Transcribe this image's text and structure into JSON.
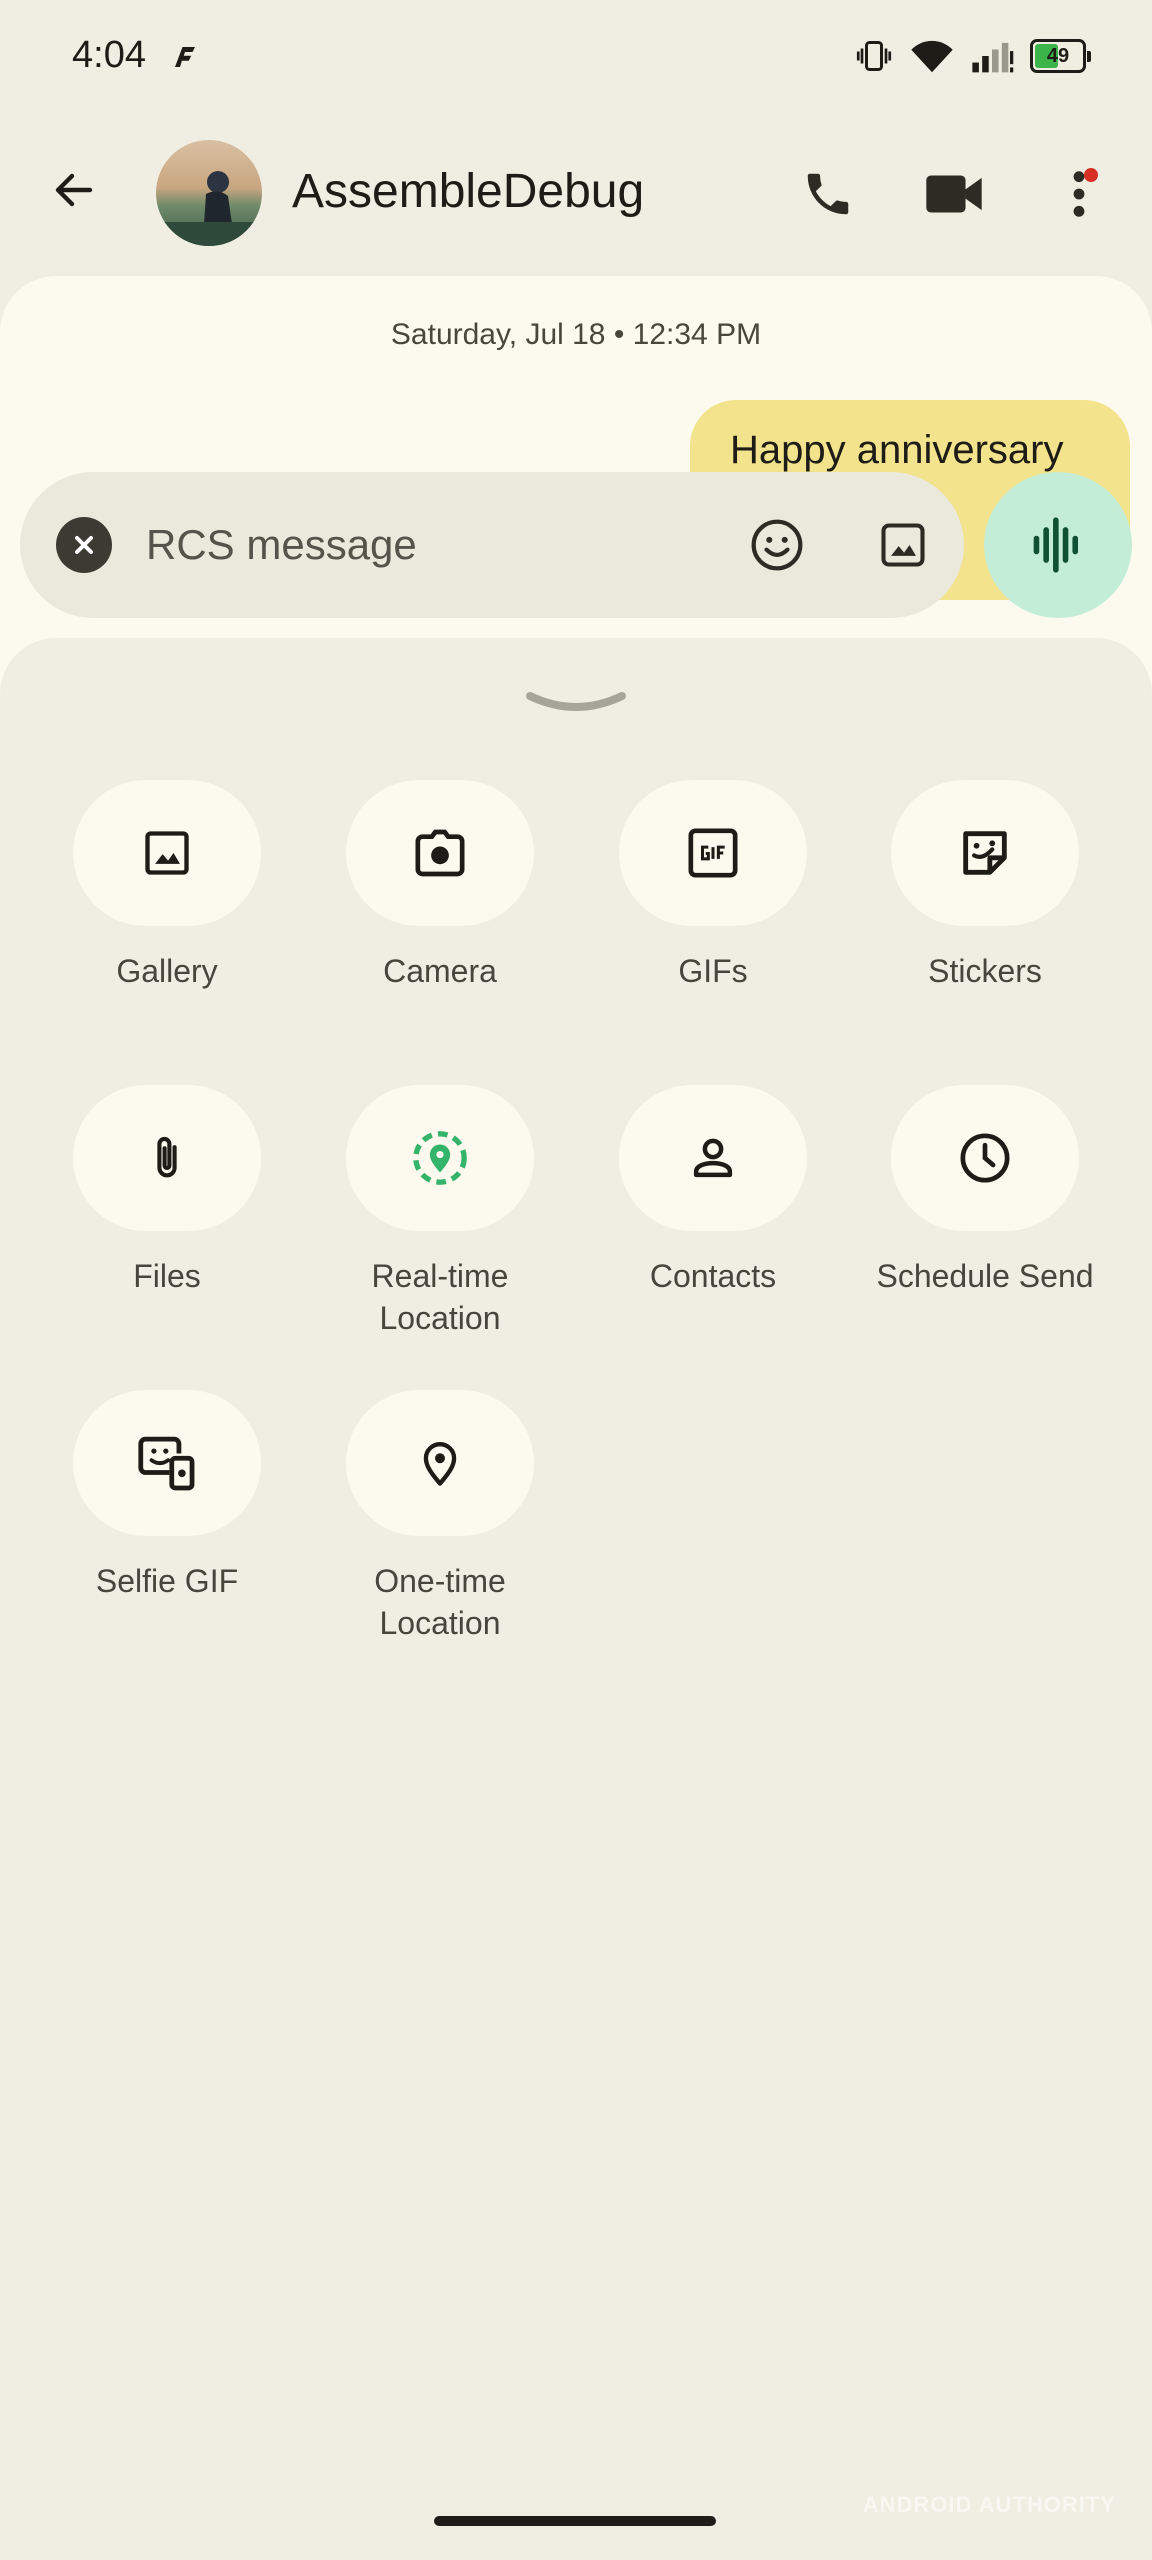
{
  "status_bar": {
    "time": "4:04",
    "battery_text": "49",
    "battery_level": 0.49,
    "icons": [
      "vibrate-icon",
      "wifi-icon",
      "signal-icon",
      "battery-icon"
    ]
  },
  "header": {
    "contact_name": "AssembleDebug",
    "icons": [
      "back-arrow-icon",
      "phone-icon",
      "video-camera-icon",
      "more-vert-icon"
    ],
    "notification_dot_color": "#d93025"
  },
  "conversation": {
    "date_label": "Saturday, Jul 18 • 12:34 PM",
    "bubble_text": "Happy anniversary",
    "bubble_color": "#f3e38c"
  },
  "compose": {
    "placeholder": "RCS message",
    "icons": [
      "close-icon",
      "emoji-icon",
      "image-icon",
      "voice-waveform-icon"
    ],
    "voice_button_color": "#c4edd8"
  },
  "attachments": {
    "items": [
      {
        "label": "Gallery",
        "icon": "gallery-icon"
      },
      {
        "label": "Camera",
        "icon": "camera-icon"
      },
      {
        "label": "GIFs",
        "icon": "gif-icon"
      },
      {
        "label": "Stickers",
        "icon": "sticker-icon"
      },
      {
        "label": "Files",
        "icon": "paperclip-icon"
      },
      {
        "label": "Real-time\nLocation",
        "icon": "live-location-icon"
      },
      {
        "label": "Contacts",
        "icon": "person-icon"
      },
      {
        "label": "Schedule Send",
        "icon": "clock-icon"
      },
      {
        "label": "Selfie GIF",
        "icon": "selfie-gif-icon"
      },
      {
        "label": "One-time\nLocation",
        "icon": "location-pin-icon"
      }
    ],
    "accent_color": "#34b36a"
  },
  "watermark": "ANDROID AUTHORITY"
}
